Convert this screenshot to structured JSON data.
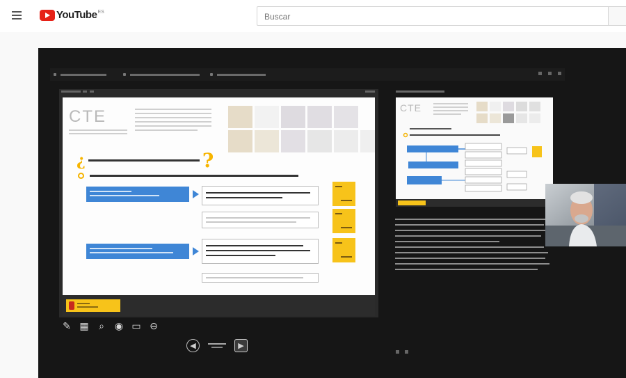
{
  "header": {
    "logo_text": "YouTube",
    "logo_region": "ES",
    "search_placeholder": "Buscar"
  },
  "icons": {
    "menu": "hamburger-menu-icon",
    "search": "search-icon"
  },
  "colors": {
    "youtube_red": "#e62117",
    "accent_yellow": "#f7c31a",
    "slide_blue": "#3f86d6",
    "presenter_bg": "#161616"
  },
  "slide": {
    "title": "CTE",
    "nav_prev_icon": "previous-slide-icon",
    "nav_next_icon": "next-slide-icon"
  }
}
